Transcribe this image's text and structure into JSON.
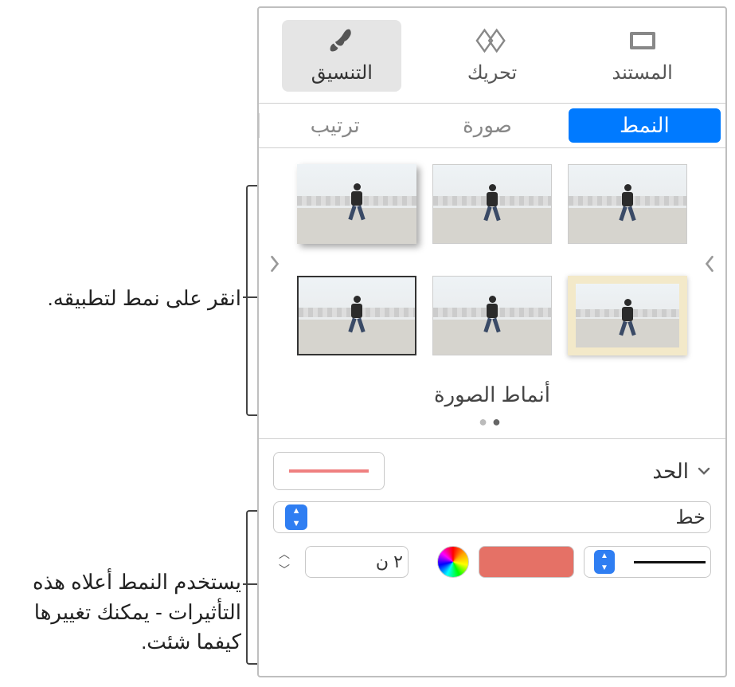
{
  "top_tabs": {
    "format": "التنسيق",
    "animate": "تحريك",
    "document": "المستند"
  },
  "sub_tabs": {
    "style": "النمط",
    "image": "صورة",
    "arrange": "ترتيب"
  },
  "styles_label": "أنماط الصورة",
  "callouts": {
    "apply_style": "انقر على نمط لتطبيقه.",
    "effects": "يستخدم النمط أعلاه هذه التأثيرات - يمكنك تغييرها كيفما شئت."
  },
  "border": {
    "title": "الحد",
    "type_label": "خط",
    "size_value": "٢ ن"
  },
  "colors": {
    "accent": "#007aff",
    "border_color": "#e57166"
  }
}
